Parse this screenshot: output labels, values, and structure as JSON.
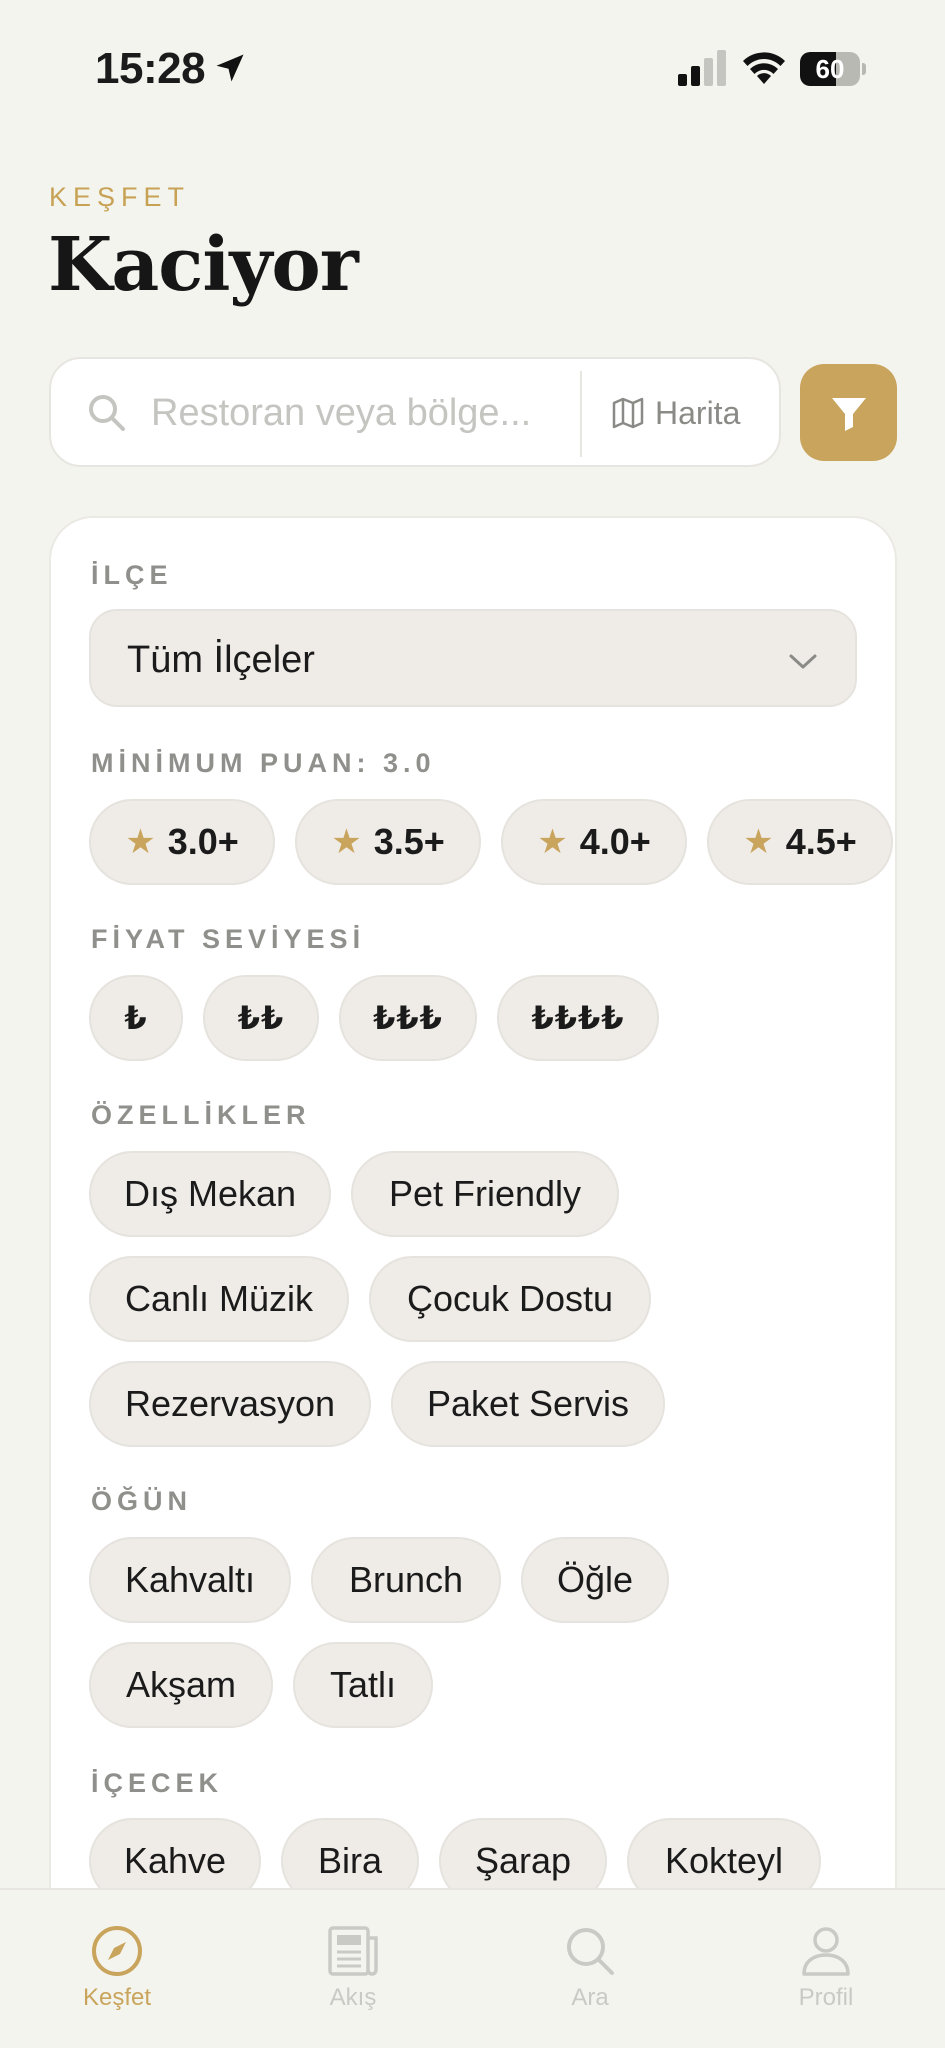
{
  "status_bar": {
    "time": "15:28",
    "battery": "60",
    "battery_level": 0.6
  },
  "header": {
    "eyebrow": "KEŞFET",
    "title": "Kaciyor"
  },
  "search": {
    "placeholder": "Restoran veya bölge...",
    "map_label": "Harita"
  },
  "filters": {
    "district": {
      "label": "İLÇE",
      "value": "Tüm İlçeler"
    },
    "rating": {
      "label": "MİNİMUM PUAN: 3.0",
      "options": [
        "3.0+",
        "3.5+",
        "4.0+",
        "4.5+"
      ]
    },
    "price": {
      "label": "FİYAT SEVİYESİ",
      "options": [
        "₺",
        "₺₺",
        "₺₺₺",
        "₺₺₺₺"
      ]
    },
    "features": {
      "label": "ÖZELLİKLER",
      "options": [
        "Dış Mekan",
        "Pet Friendly",
        "Canlı Müzik",
        "Çocuk Dostu",
        "Rezervasyon",
        "Paket Servis"
      ]
    },
    "meal": {
      "label": "ÖĞÜN",
      "options": [
        "Kahvaltı",
        "Brunch",
        "Öğle",
        "Akşam",
        "Tatlı"
      ]
    },
    "drink": {
      "label": "İÇECEK",
      "options": [
        "Kahve",
        "Bira",
        "Şarap",
        "Kokteyl"
      ]
    }
  },
  "tabs": [
    {
      "label": "Keşfet",
      "icon": "compass-icon",
      "active": true
    },
    {
      "label": "Akış",
      "icon": "newspaper-icon",
      "active": false
    },
    {
      "label": "Ara",
      "icon": "search-icon",
      "active": false
    },
    {
      "label": "Profil",
      "icon": "person-icon",
      "active": false
    }
  ],
  "colors": {
    "accent": "#c9a45c",
    "background": "#f4f4ef",
    "chip": "#efece8",
    "muted": "#c9c9c5"
  }
}
